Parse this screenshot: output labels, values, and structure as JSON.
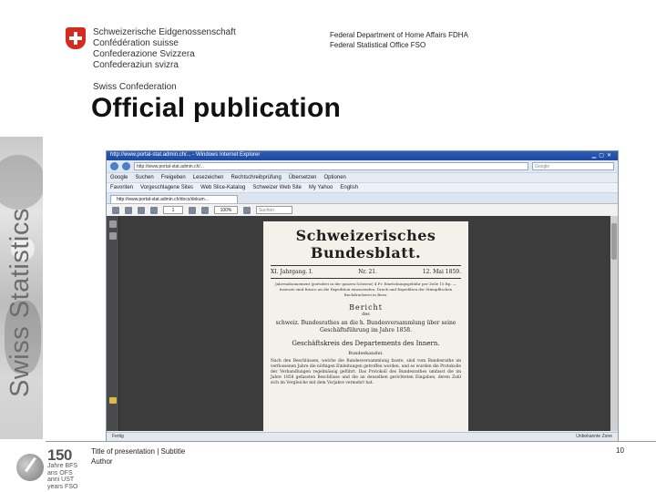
{
  "header": {
    "confederation_lines": [
      "Schweizerische Eidgenossenschaft",
      "Confédération suisse",
      "Confederazione Svizzera",
      "Confederaziun svizra"
    ],
    "confederation_en": "Swiss Confederation",
    "department": "Federal Department of Home Affairs FDHA",
    "office": "Federal Statistical Office FSO"
  },
  "page_title": "Official publication",
  "side_brand": "Swiss Statistics",
  "browser": {
    "window_title": "http://www.portal-stat.admin.ch/... - Windows Internet Explorer",
    "address": "http://www.portal-stat.admin.ch/...",
    "search_placeholder": "Google",
    "toolbar_items": [
      "Google",
      "Suchen",
      "Freigeben",
      "Lesezeichen",
      "Rechtschreibprüfung",
      "Übersetzen",
      "Optionen"
    ],
    "favorites_items": [
      "Favoriten",
      "Vorgeschlagene Sites",
      "Web Slice-Katalog",
      "Schweizer Web Site",
      "My Yahoo",
      "English"
    ],
    "tab_label": "http://www.portal-stat.admin.ch/docs/dokum...",
    "pdf_page": "1",
    "pdf_zoom": "100%",
    "pdf_search_placeholder": "Suchen",
    "status_left": "Fertig",
    "status_right": "Unbekannte Zone"
  },
  "newspaper": {
    "masthead": "Schweizerisches Bundesblatt.",
    "volume": "XI. Jahrgang. I.",
    "number": "Nr. 21.",
    "date": "12. Mai 1859.",
    "note": "Jahresabonnement (portofrei in der ganzen Schweiz) 4 Fr. Einrückungsgebühr per Zeile 15 Rp. — Inserate sind franco an die Expedition einzusenden. Druck und Expedition der Stämpflischen Buchdruckerei in Bern.",
    "heading": "Bericht",
    "sub": "des",
    "lead": "schweiz. Bundesrathes an die h. Bundesversammlung über seine Geschäftsführung im Jahre 1858.",
    "section": "Geschäftskreis des Departements des Innern.",
    "sub2": "Bundeskanzlei.",
    "body": "Nach den Beschlüssen, welche die Bundesversammlung fasste, sind vom Bundesrathe im verflossenen Jahre die nöthigen Einleitungen getroffen worden, und es wurden die Protokolle der Verhandlungen regelmässig geführt. Das Protokoll des Bundesrathes umfasst die im Jahre 1858 gefassten Beschlüsse und die an denselben gerichteten Eingaben, deren Zahl sich im Vergleiche mit dem Vorjahre vermehrt hat."
  },
  "footer": {
    "presentation_title": "Title of presentation | Subtitle",
    "author": "Author",
    "page_number": "10",
    "logo_number": "150",
    "logo_lines": [
      "Jahre BFS",
      "ans OFS",
      "anni UST",
      "years FSO"
    ]
  }
}
